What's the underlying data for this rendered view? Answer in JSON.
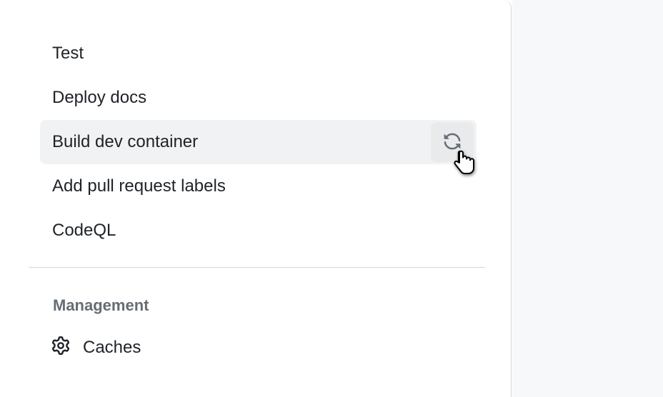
{
  "workflows": [
    {
      "label": "Test"
    },
    {
      "label": "Deploy docs"
    },
    {
      "label": "Build dev container",
      "hovered": true
    },
    {
      "label": "Add pull request labels"
    },
    {
      "label": "CodeQL"
    }
  ],
  "management": {
    "header": "Management",
    "items": [
      {
        "label": "Caches",
        "icon": "gear"
      }
    ]
  }
}
